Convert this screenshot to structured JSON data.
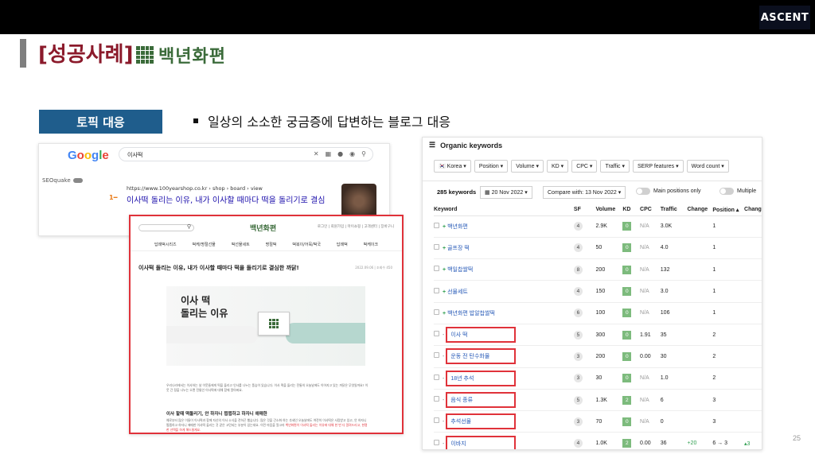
{
  "slide": {
    "title": "[성공사례]",
    "brand_name": "백년화편",
    "logo": "ASCENT",
    "topic_badge": "토픽 대응",
    "bullet_text": "일상의 소소한 궁금증에 답변하는 블로그 대응",
    "page_number": "25",
    "colors": {
      "title": "#8b1a2b",
      "badge_bg": "#1f5d8c",
      "highlight_border": "#e0323a",
      "brand_green": "#3b6b3a"
    }
  },
  "google": {
    "logo": "Google",
    "query": "이사떡",
    "seoquake": "SEOquake",
    "result_url": "https://www.100yearshop.co.kr › shop › board › view",
    "result_title": "이사떡 돌리는 이유, 내가 이사할 때마다 떡을 돌리기로 결심",
    "rank_marker": "1",
    "ellipsis": "..."
  },
  "blog": {
    "brand": "백년화편",
    "top_links": "로그인 | 회원가입 | 마이쇼핑 | 고객센터 | 장바구니",
    "nav": [
      "답례떡시리즈",
      "떡케/명절선물",
      "떡선물세트",
      "명절떡",
      "떡볶이/어묵/떡국",
      "답례떡",
      "떡케이크"
    ],
    "post_title": "이사떡 돌리는 이유, 내가 이사할 때마다 떡을 돌리기로 결심한 까닭!",
    "post_date": "2022.09.06 | 조회수 450",
    "hero_line1": "이사 떡",
    "hero_line2": "돌리는 이유",
    "paragraph1": "우리나라에서는 이사하는 날 이웃들에게 떡을 돌리고 인사를 나누는 풍습이 있습니다. 이사 떡을 돌리는 전통의 오늘날에도 이어지고 있는 까닭은 무엇일까요? 이웃 간 정을 나누는 오랜 전통인 이사떡에 대해 함께 알아봐요.",
    "subheading": "이사 할때 떡돌리기, 안 하자니 찝찝하고 하자니 애매한",
    "paragraph2": "예로부터 많은 이들이 이사떡과 함께 자신의 이사 소식을 전하곤 했습니다. 많은 것을 간소화 하는 추세인 오늘날에도 여전히 이사떡은 사랑받고 있고, 안 하자니 찝찝하고 하자니 애매한 이사떡 돌리는 것 같은 고민되는 부분이 있는데요. 이런 마음을 알고자",
    "paragraph2_highlight": "백년화편이 이사떡 돌리는 이유에 대해 한 번 다 알려드리고, 현명한 선택을 하게 해드릴게요."
  },
  "ahrefs": {
    "header": "Organic keywords",
    "filters": [
      "Korea ▾",
      "Position ▾",
      "Volume ▾",
      "KD ▾",
      "CPC ▾",
      "Traffic ▾",
      "SERP features ▾",
      "Word count ▾"
    ],
    "count": "285 keywords",
    "date": "20 Nov 2022 ▾",
    "compare": "Compare with: 13 Nov 2022 ▾",
    "toggle1": "Main positions only",
    "toggle2": "Multiple",
    "columns": [
      "Keyword",
      "SF",
      "Volume",
      "KD",
      "CPC",
      "Traffic",
      "Change",
      "Position ▴",
      "Change"
    ],
    "rows": [
      {
        "keyword": "백년화편",
        "sf": "4",
        "volume": "2.9K",
        "kd": "0",
        "cpc": "N/A",
        "traffic": "3.0K",
        "change": "",
        "position": "1",
        "pos_change": "",
        "highlight": false
      },
      {
        "keyword": "골프장 떡",
        "sf": "4",
        "volume": "50",
        "kd": "0",
        "cpc": "N/A",
        "traffic": "4.0",
        "change": "",
        "position": "1",
        "pos_change": "",
        "highlight": false
      },
      {
        "keyword": "백일찹쌀떡",
        "sf": "8",
        "volume": "200",
        "kd": "0",
        "cpc": "N/A",
        "traffic": "132",
        "change": "",
        "position": "1",
        "pos_change": "",
        "highlight": false
      },
      {
        "keyword": "선물세트",
        "sf": "4",
        "volume": "150",
        "kd": "0",
        "cpc": "N/A",
        "traffic": "3.0",
        "change": "",
        "position": "1",
        "pos_change": "",
        "highlight": false
      },
      {
        "keyword": "백년화편 밥알찹쌀떡",
        "sf": "6",
        "volume": "100",
        "kd": "0",
        "cpc": "N/A",
        "traffic": "106",
        "change": "",
        "position": "1",
        "pos_change": "",
        "highlight": false
      },
      {
        "keyword": "이사 떡",
        "sf": "5",
        "volume": "300",
        "kd": "0",
        "cpc": "1.91",
        "traffic": "35",
        "change": "",
        "position": "2",
        "pos_change": "",
        "highlight": true
      },
      {
        "keyword": "운동 전 탄수화물",
        "sf": "3",
        "volume": "200",
        "kd": "0",
        "cpc": "0.00",
        "traffic": "30",
        "change": "",
        "position": "2",
        "pos_change": "",
        "highlight": true
      },
      {
        "keyword": "18년 추석",
        "sf": "3",
        "volume": "30",
        "kd": "0",
        "cpc": "N/A",
        "traffic": "1.0",
        "change": "",
        "position": "2",
        "pos_change": "",
        "highlight": true
      },
      {
        "keyword": "음식 종류",
        "sf": "5",
        "volume": "1.3K",
        "kd": "2",
        "cpc": "N/A",
        "traffic": "6",
        "change": "",
        "position": "3",
        "pos_change": "",
        "highlight": true
      },
      {
        "keyword": "추석선물",
        "sf": "3",
        "volume": "70",
        "kd": "0",
        "cpc": "N/A",
        "traffic": "0",
        "change": "",
        "position": "3",
        "pos_change": "",
        "highlight": true
      },
      {
        "keyword": "이바지",
        "sf": "4",
        "volume": "1.0K",
        "kd": "2",
        "cpc": "0.00",
        "traffic": "36",
        "change": "+20",
        "position": "6 → 3",
        "pos_change": "▴3",
        "highlight": true
      }
    ]
  }
}
